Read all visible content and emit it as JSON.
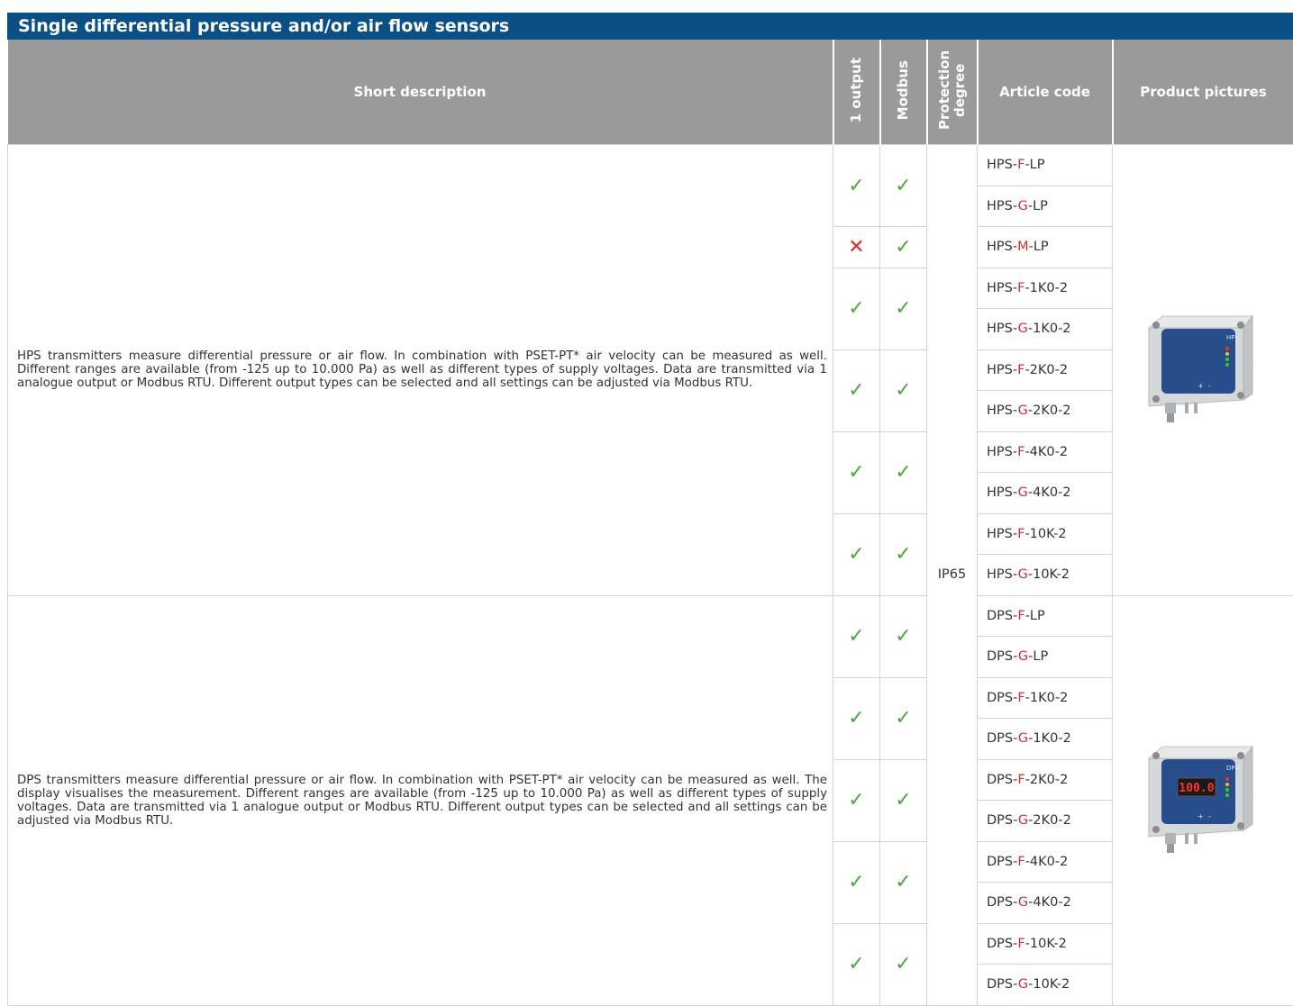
{
  "title": "Single differential pressure and/or air flow sensors",
  "headers": {
    "description": "Short description",
    "output": "1 output",
    "modbus": "Modbus",
    "protection": "Protection degree",
    "article": "Article code",
    "pictures": "Product pictures"
  },
  "protection_value": "IP65",
  "hps": {
    "description": "HPS transmitters measure differential pressure or air flow. In combination with PSET-PT* air velocity can be measured as well. Different ranges are available (from -125 up to 10.000 Pa) as well as different types of supply voltages. Data are transmitted via 1 analogue output or Modbus RTU. Different output types can be selected and all settings can be adjusted via Modbus RTU.",
    "device_label": "HPS",
    "groups": [
      {
        "output": "check",
        "modbus": "check",
        "codes": [
          {
            "prefix": "HPS-",
            "variant": "F",
            "suffix": "-LP"
          },
          {
            "prefix": "HPS-",
            "variant": "G",
            "suffix": "-LP"
          }
        ]
      },
      {
        "output": "cross",
        "modbus": "check",
        "codes": [
          {
            "prefix": "HPS-",
            "variant": "M",
            "suffix": "-LP"
          }
        ]
      },
      {
        "output": "check",
        "modbus": "check",
        "codes": [
          {
            "prefix": "HPS-",
            "variant": "F",
            "suffix": "-1K0-2"
          },
          {
            "prefix": "HPS-",
            "variant": "G",
            "suffix": "-1K0-2"
          }
        ]
      },
      {
        "output": "check",
        "modbus": "check",
        "codes": [
          {
            "prefix": "HPS-",
            "variant": "F",
            "suffix": "-2K0-2"
          },
          {
            "prefix": "HPS-",
            "variant": "G",
            "suffix": "-2K0-2"
          }
        ]
      },
      {
        "output": "check",
        "modbus": "check",
        "codes": [
          {
            "prefix": "HPS-",
            "variant": "F",
            "suffix": "-4K0-2"
          },
          {
            "prefix": "HPS-",
            "variant": "G",
            "suffix": "-4K0-2"
          }
        ]
      },
      {
        "output": "check",
        "modbus": "check",
        "codes": [
          {
            "prefix": "HPS-",
            "variant": "F",
            "suffix": "-10K-2"
          },
          {
            "prefix": "HPS-",
            "variant": "G",
            "suffix": "-10K-2"
          }
        ]
      }
    ]
  },
  "dps": {
    "description": "DPS transmitters measure differential pressure or air flow. In combination with PSET-PT* air velocity can be measured as well. The display visualises the measurement. Different ranges are available (from -125 up to 10.000 Pa) as well as different types of supply voltages. Data are transmitted via 1 analogue output or Modbus RTU. Different output types can be selected and all settings can be adjusted via Modbus RTU.",
    "device_label": "DPS",
    "display_value": "100.0",
    "groups": [
      {
        "output": "check",
        "modbus": "check",
        "codes": [
          {
            "prefix": "DPS-",
            "variant": "F",
            "suffix": "-LP"
          },
          {
            "prefix": "DPS-",
            "variant": "G",
            "suffix": "-LP"
          }
        ]
      },
      {
        "output": "check",
        "modbus": "check",
        "codes": [
          {
            "prefix": "DPS-",
            "variant": "F",
            "suffix": "-1K0-2"
          },
          {
            "prefix": "DPS-",
            "variant": "G",
            "suffix": "-1K0-2"
          }
        ]
      },
      {
        "output": "check",
        "modbus": "check",
        "codes": [
          {
            "prefix": "DPS-",
            "variant": "F",
            "suffix": "-2K0-2"
          },
          {
            "prefix": "DPS-",
            "variant": "G",
            "suffix": "-2K0-2"
          }
        ]
      },
      {
        "output": "check",
        "modbus": "check",
        "codes": [
          {
            "prefix": "DPS-",
            "variant": "F",
            "suffix": "-4K0-2"
          },
          {
            "prefix": "DPS-",
            "variant": "G",
            "suffix": "-4K0-2"
          }
        ]
      },
      {
        "output": "check",
        "modbus": "check",
        "codes": [
          {
            "prefix": "DPS-",
            "variant": "F",
            "suffix": "-10K-2"
          },
          {
            "prefix": "DPS-",
            "variant": "G",
            "suffix": "-10K-2"
          }
        ]
      }
    ]
  },
  "colors": {
    "header_bar": "#0a4f86",
    "header_cells": "#9a9a9a",
    "check": "#4aa83c",
    "cross": "#d32d35",
    "variant": "#d32d35"
  }
}
